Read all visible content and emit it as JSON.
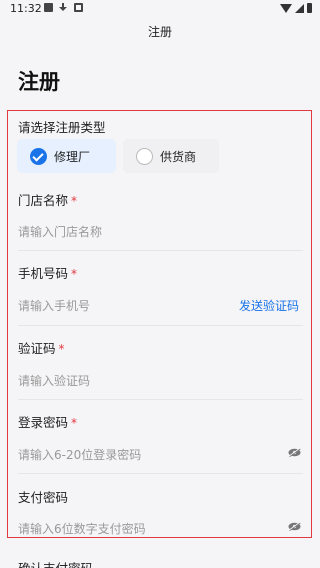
{
  "status_bar": {
    "time": "11:32"
  },
  "nav": {
    "title": "注册"
  },
  "page": {
    "title": "注册"
  },
  "form": {
    "type_label": "请选择注册类型",
    "type_options": [
      {
        "label": "修理厂",
        "selected": true
      },
      {
        "label": "供货商",
        "selected": false
      }
    ],
    "required_mark": "*",
    "fields": [
      {
        "label": "门店名称",
        "placeholder": "请输入门店名称",
        "required": true
      },
      {
        "label": "手机号码",
        "placeholder": "请输入手机号",
        "required": true,
        "action": "发送验证码"
      },
      {
        "label": "验证码",
        "placeholder": "请输入验证码",
        "required": true
      },
      {
        "label": "登录密码",
        "placeholder": "请输入6-20位登录密码",
        "required": true
      },
      {
        "label": "支付密码",
        "placeholder": "请输入6位数字支付密码",
        "required": false
      }
    ]
  },
  "next_section": {
    "label": "确认支付密码"
  },
  "colors": {
    "accent": "#1a73e8",
    "required": "#e0393e",
    "highlight_box": "#e0393e"
  }
}
